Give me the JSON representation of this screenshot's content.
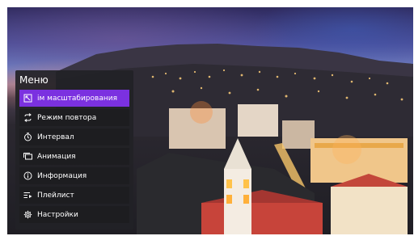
{
  "menu": {
    "title": "Меню",
    "items": [
      {
        "label": "ім масштабирования",
        "icon": "zoom-fit-icon",
        "active": true
      },
      {
        "label": "Режим повтора",
        "icon": "repeat-icon",
        "active": false
      },
      {
        "label": "Интервал",
        "icon": "timer-icon",
        "active": false
      },
      {
        "label": "Анимация",
        "icon": "slides-icon",
        "active": false
      },
      {
        "label": "Информация",
        "icon": "info-icon",
        "active": false
      },
      {
        "label": "Плейлист",
        "icon": "playlist-icon",
        "active": false
      },
      {
        "label": "Настройки",
        "icon": "settings-icon",
        "active": false
      }
    ]
  },
  "colors": {
    "accent": "#7b31e0",
    "menu_bg": "#222226",
    "item_bg": "#1d1d20",
    "text": "#ffffff"
  }
}
